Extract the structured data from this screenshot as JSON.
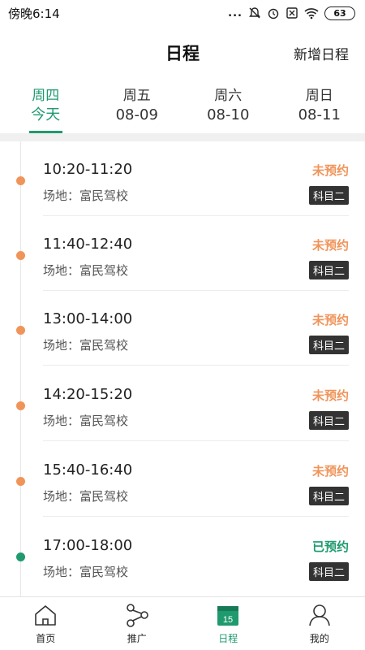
{
  "status_bar": {
    "time": "傍晚6:14",
    "battery": "63",
    "dots": "...",
    "icons": [
      "mute-icon",
      "alarm-icon",
      "sim-off-icon",
      "wifi-icon",
      "battery-icon"
    ]
  },
  "nav": {
    "title": "日程",
    "action": "新增日程"
  },
  "week_tabs": [
    {
      "weekday": "周四",
      "date": "今天",
      "active": true
    },
    {
      "weekday": "周五",
      "date": "08-09",
      "active": false
    },
    {
      "weekday": "周六",
      "date": "08-10",
      "active": false
    },
    {
      "weekday": "周日",
      "date": "08-11",
      "active": false
    }
  ],
  "colors": {
    "accent": "#1f9a6e",
    "unbooked": "#f0945a",
    "booked": "#1f9a6e",
    "badge": "#333333"
  },
  "schedule": [
    {
      "time": "10:20-11:20",
      "venue": "场地：富民驾校",
      "status": "未预约",
      "subject": "科目二",
      "booked": false
    },
    {
      "time": "11:40-12:40",
      "venue": "场地：富民驾校",
      "status": "未预约",
      "subject": "科目二",
      "booked": false
    },
    {
      "time": "13:00-14:00",
      "venue": "场地：富民驾校",
      "status": "未预约",
      "subject": "科目二",
      "booked": false
    },
    {
      "time": "14:20-15:20",
      "venue": "场地：富民驾校",
      "status": "未预约",
      "subject": "科目二",
      "booked": false
    },
    {
      "time": "15:40-16:40",
      "venue": "场地：富民驾校",
      "status": "未预约",
      "subject": "科目二",
      "booked": false
    },
    {
      "time": "17:00-18:00",
      "venue": "场地：富民驾校",
      "status": "已预约",
      "subject": "科目二",
      "booked": true
    }
  ],
  "tab_bar": [
    {
      "label": "首页",
      "icon": "home-icon",
      "active": false
    },
    {
      "label": "推广",
      "icon": "share-icon",
      "active": false
    },
    {
      "label": "日程",
      "icon": "calendar-icon",
      "active": true,
      "badge": "15"
    },
    {
      "label": "我的",
      "icon": "user-icon",
      "active": false
    }
  ]
}
